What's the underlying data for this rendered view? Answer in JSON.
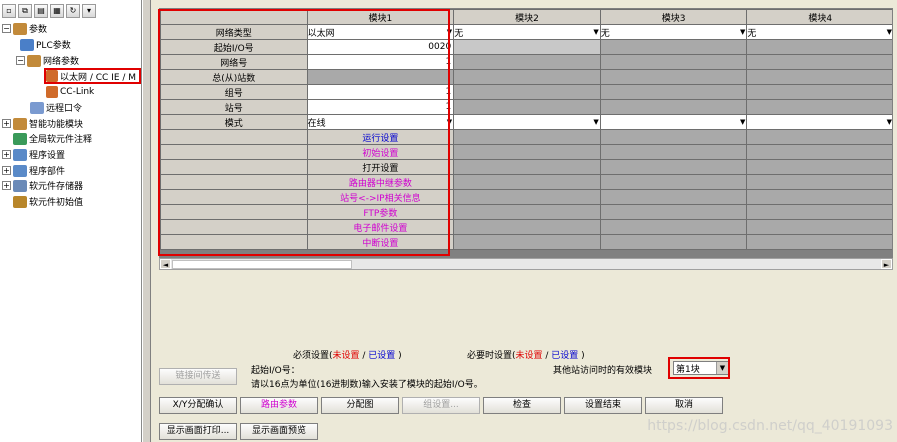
{
  "tree": {
    "items": [
      {
        "label": "参数",
        "exp": "−"
      },
      {
        "label": "PLC参数"
      },
      {
        "label": "网络参数",
        "exp": "−"
      },
      {
        "label": "以太网 / CC IE / M"
      },
      {
        "label": "CC-Link"
      },
      {
        "label": "远程口令"
      },
      {
        "label": "智能功能模块",
        "exp": "+"
      },
      {
        "label": "全局软元件注释"
      },
      {
        "label": "程序设置",
        "exp": "+"
      },
      {
        "label": "程序部件",
        "exp": "+"
      },
      {
        "label": "软元件存储器",
        "exp": "+"
      },
      {
        "label": "软元件初始值"
      }
    ]
  },
  "grid": {
    "columns": [
      "模块1",
      "模块2",
      "模块3",
      "模块4"
    ],
    "rows": [
      {
        "label": "网络类型",
        "m1": "以太网",
        "m2": "无",
        "m3": "无",
        "m4": "无"
      },
      {
        "label": "起始I/O号",
        "m1": "0020"
      },
      {
        "label": "网络号",
        "m1": "1"
      },
      {
        "label": "总(从)站数",
        "m1": ""
      },
      {
        "label": "组号",
        "m1": "1"
      },
      {
        "label": "站号",
        "m1": "1"
      },
      {
        "label": "模式",
        "m1": "在线"
      }
    ],
    "links": [
      {
        "label": "运行设置",
        "color": "#0000d0"
      },
      {
        "label": "初始设置",
        "color": "#d000d0"
      },
      {
        "label": "打开设置",
        "color": "#000000"
      },
      {
        "label": "路由器中继参数",
        "color": "#d000d0"
      },
      {
        "label": "站号<->IP相关信息",
        "color": "#d000d0"
      },
      {
        "label": "FTP参数",
        "color": "#d000d0"
      },
      {
        "label": "电子邮件设置",
        "color": "#d000d0"
      },
      {
        "label": "中断设置",
        "color": "#d000d0"
      }
    ]
  },
  "legend": {
    "required_prefix": "必须设置(",
    "required_unset": "未设置",
    "slash": " / ",
    "required_set": "已设置",
    "close": " )",
    "optional_prefix": "必要时设置(",
    "optional_unset": "未设置",
    "optional_set": "已设置",
    "optional_close": " )"
  },
  "info": {
    "start_io_label": "起始I/O号：",
    "hint": "请以16点为单位(16进制数)输入安装了模块的起始I/O号。",
    "other_station_label": "其他站访问时的有效模块",
    "module_selected": "第1块"
  },
  "buttons": {
    "link_transfer": "链接间传送",
    "xy_confirm": "X/Y分配确认",
    "routing": "路由参数",
    "assignment": "分配图",
    "group_setting": "组设置...",
    "check": "检查",
    "setting_end": "设置结束",
    "cancel": "取消",
    "print_window": "显示画面打印...",
    "print_preview": "显示画面预览"
  },
  "watermark": "https://blog.csdn.net/qq_40191093",
  "colors": {
    "highlight": "#e00000",
    "link_magenta": "#d000d0",
    "link_blue": "#0000d0"
  }
}
